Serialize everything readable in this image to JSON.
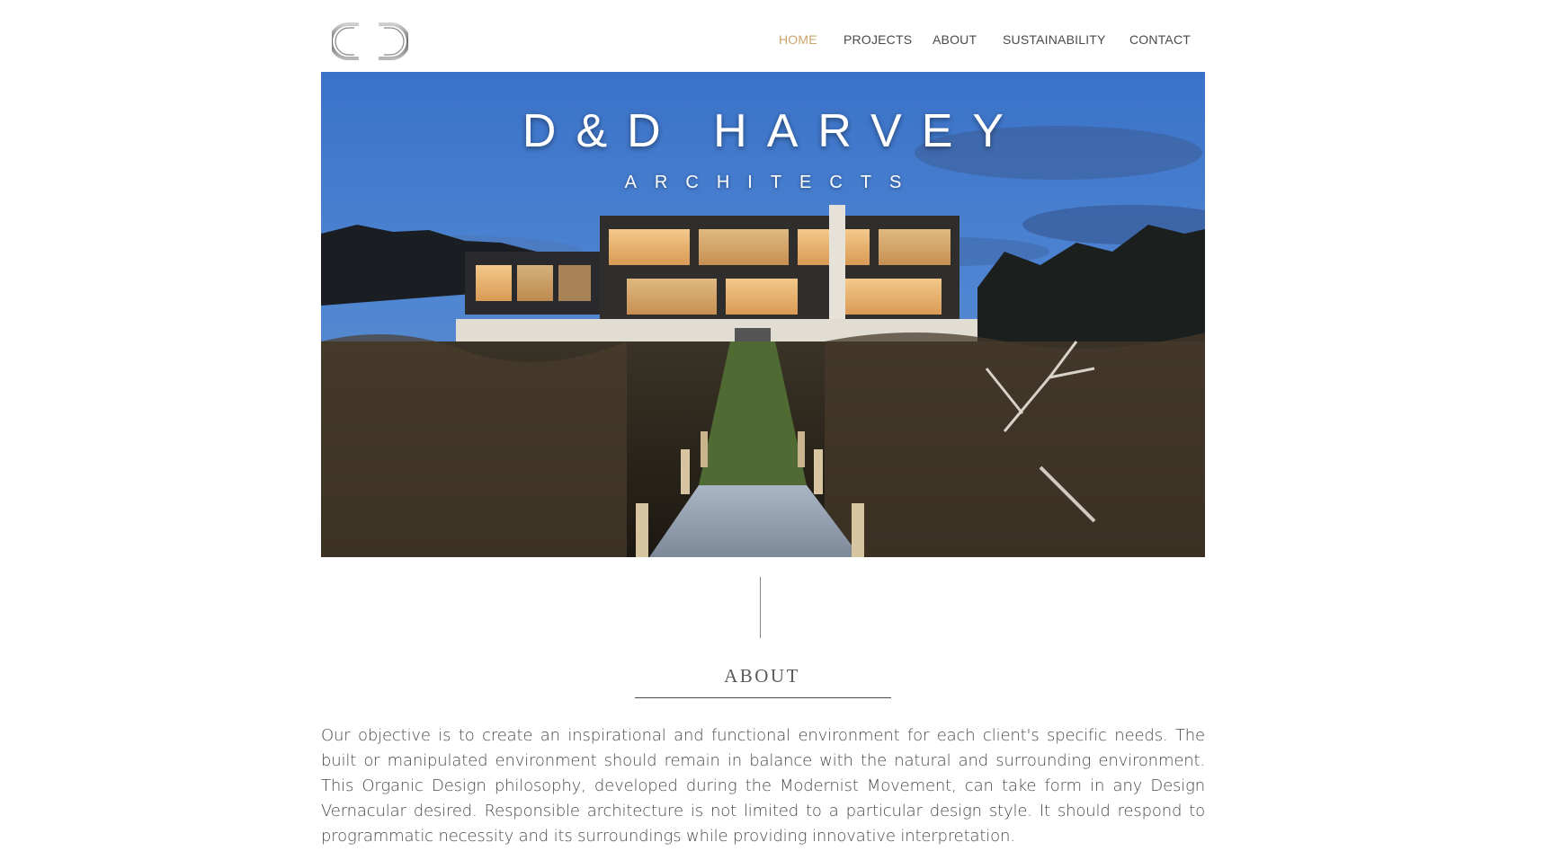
{
  "header": {
    "logo_icon": "dh-monogram-logo",
    "nav": [
      {
        "label": "HOME",
        "active": true
      },
      {
        "label": "PROJECTS",
        "active": false
      },
      {
        "label": "ABOUT",
        "active": false
      },
      {
        "label": "SUSTAINABILITY",
        "active": false
      },
      {
        "label": "CONTACT",
        "active": false
      }
    ],
    "active_color": "#c9a66b",
    "nav_color": "#4a4a4a"
  },
  "hero": {
    "title": "D&D HARVEY",
    "subtitle": "ARCHITECTS",
    "image_subject": "modern-house-at-dusk-with-boardwalk"
  },
  "about": {
    "heading": "ABOUT",
    "body": "Our objective is to create an inspirational and functional environment for each client's specific needs. The built or manipulated environment should remain in balance with the natural and surrounding environment. This Organic Design philosophy, developed during the Modernist Movement, can take form in any Design Vernacular desired. Responsible architecture is not limited to a particular design style. It should respond to programmatic necessity and its surroundings while providing innovative interpretation."
  }
}
